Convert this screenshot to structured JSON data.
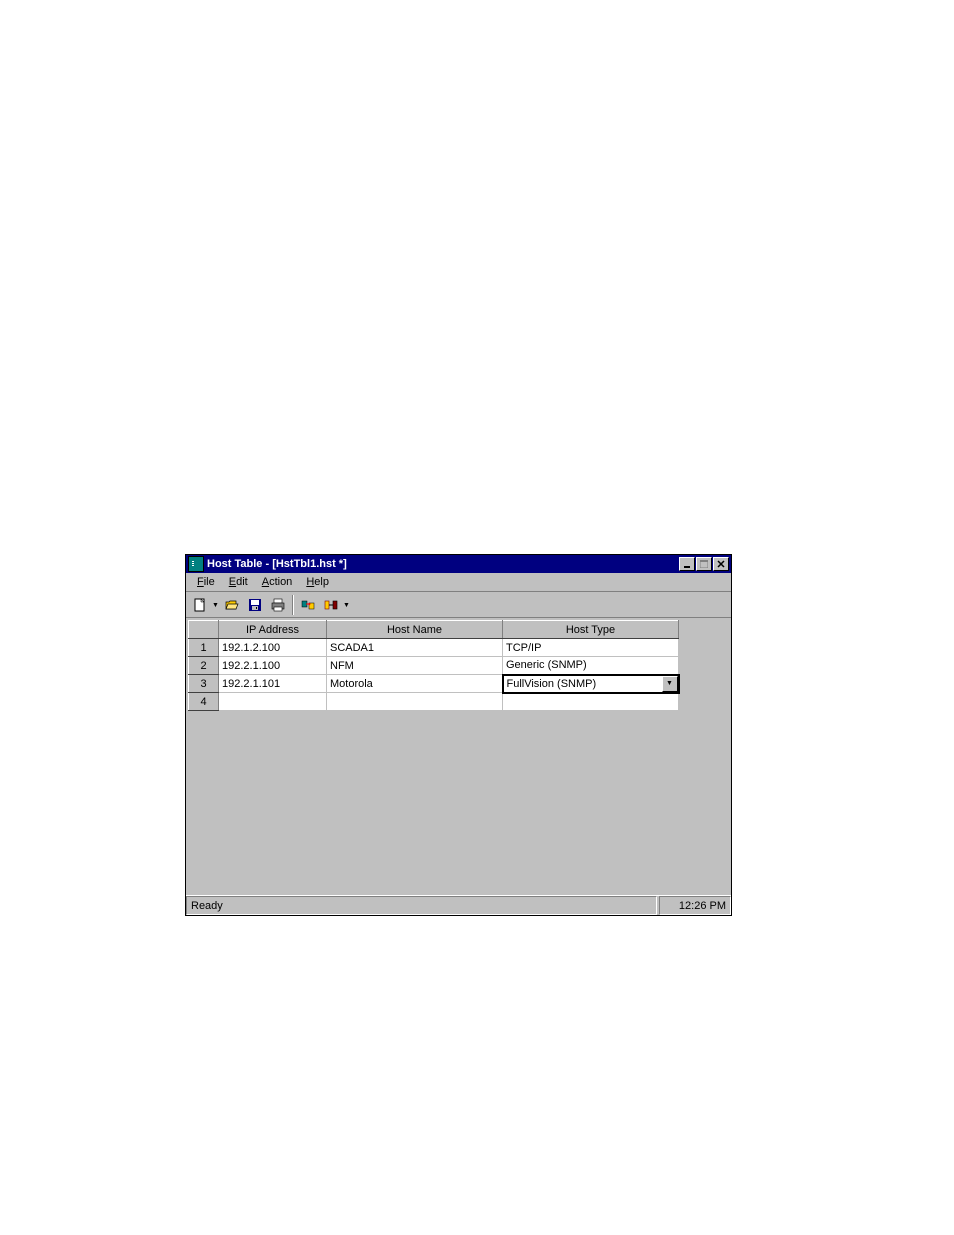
{
  "window": {
    "title": "Host Table - [HstTbl1.hst *]"
  },
  "menubar": {
    "items": [
      {
        "label": "File",
        "accel": "F"
      },
      {
        "label": "Edit",
        "accel": "E"
      },
      {
        "label": "Action",
        "accel": "A"
      },
      {
        "label": "Help",
        "accel": "H"
      }
    ]
  },
  "toolbar": {
    "icons": [
      "new",
      "open",
      "save",
      "print",
      "custom1",
      "custom2"
    ]
  },
  "grid": {
    "columns": [
      "IP Address",
      "Host Name",
      "Host Type"
    ],
    "rows": [
      {
        "n": "1",
        "ip": "192.1.2.100",
        "name": "SCADA1",
        "type": "TCP/IP",
        "dropdown": false
      },
      {
        "n": "2",
        "ip": "192.2.1.100",
        "name": "NFM",
        "type": "Generic (SNMP)",
        "dropdown": false
      },
      {
        "n": "3",
        "ip": "192.2.1.101",
        "name": "Motorola",
        "type": "FullVision (SNMP)",
        "dropdown": true
      },
      {
        "n": "4",
        "ip": "",
        "name": "",
        "type": "",
        "dropdown": false
      }
    ]
  },
  "statusbar": {
    "text": "Ready",
    "time": "12:26 PM"
  }
}
